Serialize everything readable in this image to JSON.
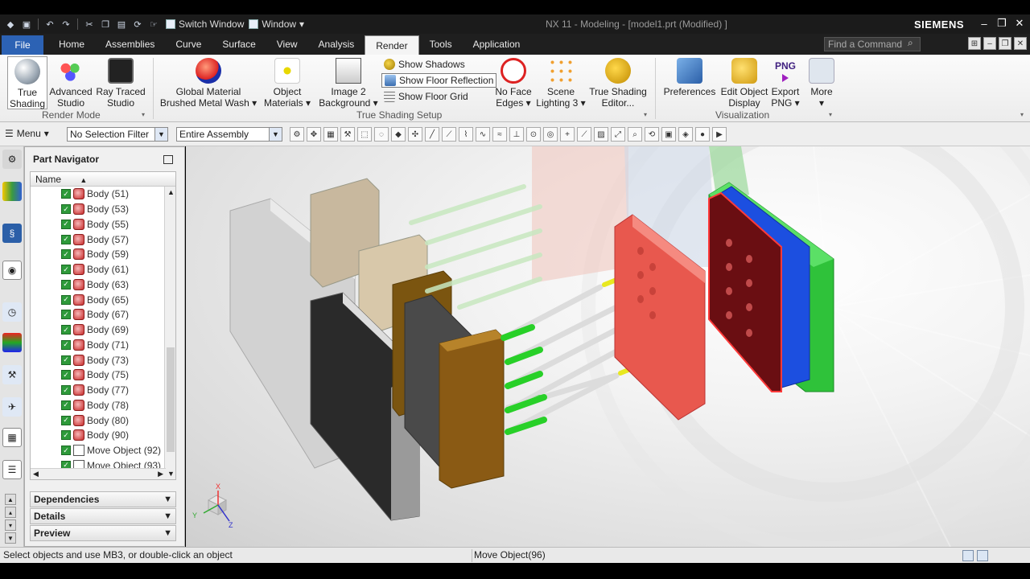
{
  "titlebar": {
    "switch_window": "Switch Window",
    "window_menu": "Window",
    "title": "NX 11 - Modeling - [model1.prt (Modified) ]",
    "brand": "SIEMENS"
  },
  "tabs": {
    "file": "File",
    "items": [
      "Home",
      "Assemblies",
      "Curve",
      "Surface",
      "View",
      "Analysis",
      "Render",
      "Tools",
      "Application"
    ],
    "active": "Render",
    "find_placeholder": "Find a Command"
  },
  "ribbon": {
    "render_mode": {
      "group": "Render Mode",
      "true_shading": [
        "True",
        "Shading"
      ],
      "advanced_studio": [
        "Advanced",
        "Studio"
      ],
      "ray_traced_studio": [
        "Ray Traced",
        "Studio"
      ]
    },
    "true_shading_setup": {
      "group": "True Shading Setup",
      "global_material": [
        "Global Material",
        "Brushed Metal Wash"
      ],
      "object_materials": [
        "Object",
        "Materials"
      ],
      "image2_background": [
        "Image 2",
        "Background"
      ],
      "show_shadows": "Show Shadows",
      "show_floor_reflection": "Show Floor Reflection",
      "show_floor_grid": "Show Floor Grid",
      "no_face_edges": [
        "No Face",
        "Edges"
      ],
      "scene_lighting": [
        "Scene",
        "Lighting 3"
      ],
      "true_shading_editor": [
        "True Shading",
        "Editor..."
      ]
    },
    "visualization": {
      "group": "Visualization",
      "preferences": "Preferences",
      "edit_object_display": [
        "Edit Object",
        "Display"
      ],
      "export_png": [
        "Export",
        "PNG"
      ],
      "png_badge": "PNG",
      "more": "More"
    }
  },
  "selbar": {
    "menu": "Menu",
    "selection_filter": "No Selection Filter",
    "scope": "Entire Assembly"
  },
  "navigator": {
    "title": "Part Navigator",
    "column_name": "Name",
    "rows": [
      "Body (51)",
      "Body (53)",
      "Body (55)",
      "Body (57)",
      "Body (59)",
      "Body (61)",
      "Body (63)",
      "Body (65)",
      "Body (67)",
      "Body (69)",
      "Body (71)",
      "Body (73)",
      "Body (75)",
      "Body (77)",
      "Body (78)",
      "Body (80)",
      "Body (90)",
      "Move Object (92)",
      "Move Object (93)"
    ],
    "panels": [
      "Dependencies",
      "Details",
      "Preview"
    ]
  },
  "viewport": {
    "axes": {
      "x": "X",
      "y": "Y",
      "z": "Z"
    }
  },
  "status": {
    "prompt": "Select objects and use MB3, or double-click an object",
    "info": "Move Object(96)"
  },
  "colors": {
    "file_tab": "#2c62b4",
    "plate_red": "#e8584e",
    "plate_blue": "#1c4fe0",
    "plate_green": "#2fc23a",
    "pin_green": "#28d028",
    "pin_yellow": "#e8e820",
    "block_brown": "#8a5a14"
  }
}
